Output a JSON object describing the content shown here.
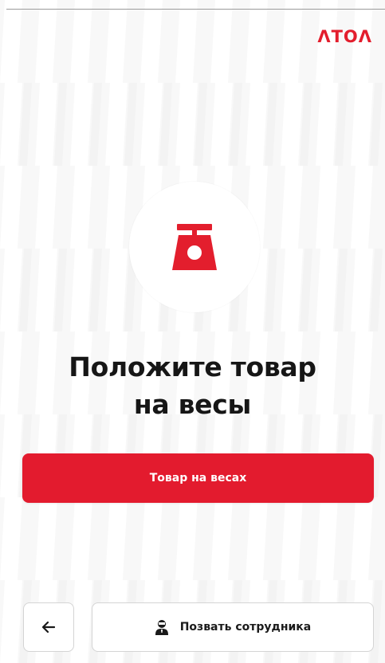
{
  "brand": {
    "logo_text": "ΛTOΛ",
    "accent_color": "#e31e2d"
  },
  "icons": {
    "scale": "scale-icon",
    "back": "arrow-left-icon",
    "staff": "staff-person-icon"
  },
  "main": {
    "title_line1": "Положите товар",
    "title_line2": "на весы",
    "primary_button_label": "Товар на весах"
  },
  "footer": {
    "call_staff_label": "Позвать сотрудника"
  }
}
